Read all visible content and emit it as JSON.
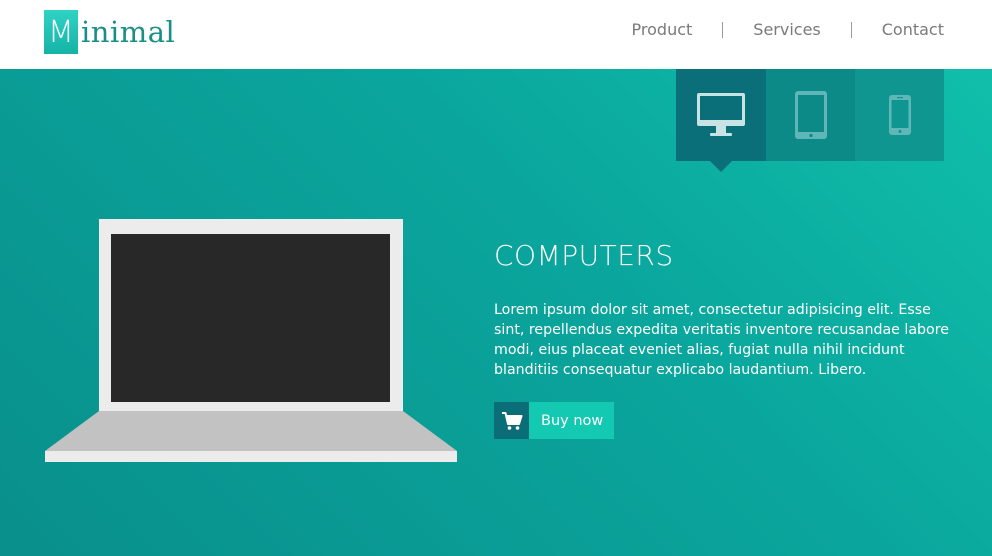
{
  "brand": {
    "logo_letter": "M",
    "logo_rest": "inimal"
  },
  "nav": {
    "items": [
      {
        "label": "Product"
      },
      {
        "label": "Services"
      },
      {
        "label": "Contact"
      }
    ]
  },
  "device_tabs": [
    {
      "icon": "desktop-icon",
      "active": true
    },
    {
      "icon": "tablet-icon",
      "active": false
    },
    {
      "icon": "phone-icon",
      "active": false
    }
  ],
  "hero": {
    "title": "COMPUTERS",
    "body": "Lorem ipsum dolor sit amet, consectetur adipisicing elit. Esse sint, repellendus expedita veritatis inventore recusandae labore modi, eius placeat eveniet alias, fugiat nulla nihil incidunt blanditiis consequatur explicabo laudantium. Libero.",
    "buy_label": "Buy now",
    "buy_icon": "cart-icon"
  },
  "colors": {
    "accent": "#13c9b2",
    "dark_teal": "#0b6d78",
    "brand_text": "#1a8f88"
  }
}
